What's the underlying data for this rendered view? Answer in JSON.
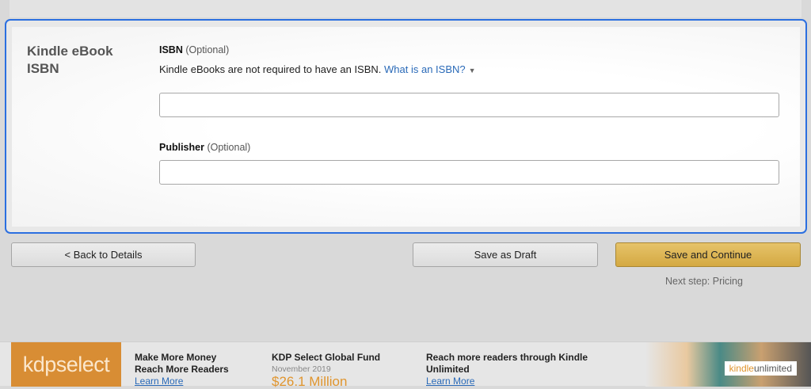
{
  "section": {
    "title": "Kindle eBook ISBN"
  },
  "isbn": {
    "label": "ISBN",
    "optional": "(Optional)",
    "help": "Kindle eBooks are not required to have an ISBN.",
    "help_link": "What is an ISBN?",
    "value": ""
  },
  "publisher": {
    "label": "Publisher",
    "optional": "(Optional)",
    "value": ""
  },
  "buttons": {
    "back": "< Back to Details",
    "draft": "Save as Draft",
    "continue": "Save and Continue",
    "next_step": "Next step: Pricing"
  },
  "banner": {
    "logo": "kdpselect",
    "promo1": {
      "line1": "Make More Money",
      "line2": "Reach More Readers",
      "link": "Learn More"
    },
    "promo2": {
      "title": "KDP Select Global Fund",
      "date": "November 2019",
      "amount": "$26.1 Million"
    },
    "promo3": {
      "title": "Reach more readers through Kindle Unlimited",
      "link": "Learn More"
    },
    "ku_logo": "kindleunlimited"
  },
  "colors": {
    "accent": "#2b6fe0",
    "primary_button": "#d4a942",
    "kdp_orange": "#d88d34",
    "link": "#2a6ab8"
  }
}
